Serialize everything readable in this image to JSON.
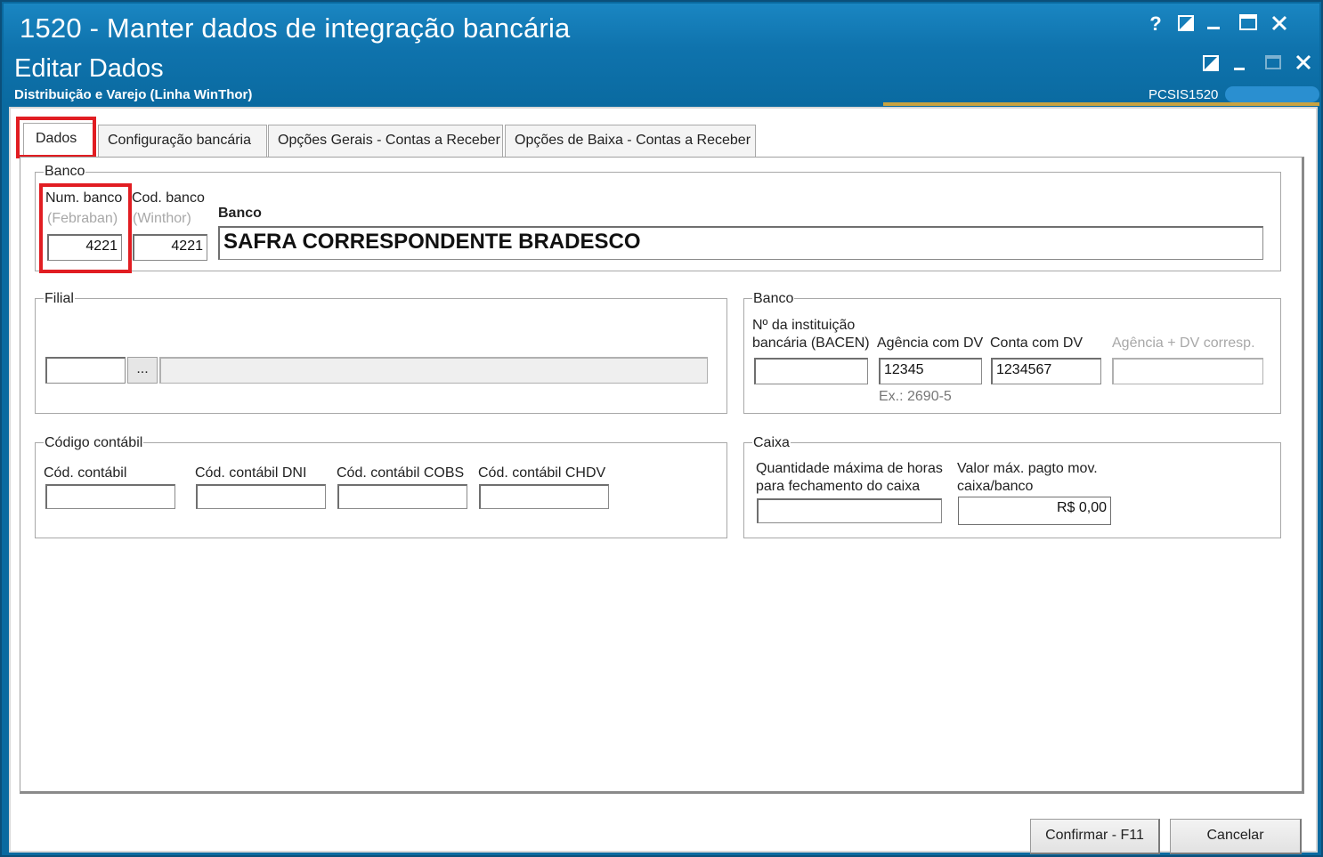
{
  "window": {
    "title": "1520 - Manter dados de integração bancária",
    "buttons": {
      "help": "?",
      "restore": "◪",
      "minimize": "‗",
      "maximize": "☐",
      "close": "✕"
    }
  },
  "subheader": {
    "title": "Editar Dados",
    "subtitle": "Distribuição e Varejo (Linha WinThor)",
    "code": "PCSIS1520"
  },
  "tabs": [
    {
      "label": "Dados"
    },
    {
      "label": "Configuração bancária"
    },
    {
      "label": "Opções Gerais - Contas a Receber"
    },
    {
      "label": "Opções de Baixa - Contas a Receber"
    }
  ],
  "banco_group": {
    "legend": "Banco",
    "num_banco_label": "Num. banco",
    "num_banco_sub": "(Febraban)",
    "num_banco_value": "4221",
    "cod_banco_label": "Cod. banco",
    "cod_banco_sub": "(Winthor)",
    "cod_banco_value": "4221",
    "banco_label": "Banco",
    "banco_value": "SAFRA CORRESPONDENTE BRADESCO"
  },
  "filial_group": {
    "legend": "Filial",
    "code_value": "",
    "browse_label": "...",
    "name_value": ""
  },
  "banco2_group": {
    "legend": "Banco",
    "bacen_label_1": "Nº da instituição",
    "bacen_label_2": "bancária (BACEN)",
    "bacen_value": "",
    "agencia_label": "Agência com DV",
    "agencia_value": "12345",
    "agencia_hint": "Ex.: 2690-5",
    "conta_label": "Conta com DV",
    "conta_value": "1234567",
    "ag_corresp_label": "Agência + DV corresp.",
    "ag_corresp_value": ""
  },
  "codigo_group": {
    "legend": "Código contábil",
    "cod_contabil_label": "Cód. contábil",
    "cod_dni_label": "Cód. contábil DNI",
    "cod_cobs_label": "Cód. contábil COBS",
    "cod_chdv_label": "Cód. contábil CHDV"
  },
  "caixa_group": {
    "legend": "Caixa",
    "horas_label_1": "Quantidade máxima de horas",
    "horas_label_2": "para fechamento do caixa",
    "horas_value": "",
    "valor_label_1": "Valor máx. pagto mov.",
    "valor_label_2": "caixa/banco",
    "valor_value": "R$ 0,00"
  },
  "footer": {
    "confirm_label": "Confirmar - F11",
    "cancel_label": "Cancelar"
  },
  "colors": {
    "titlebar": "#1a86c2",
    "highlight": "#e11d22",
    "accent": "#c9a341"
  }
}
